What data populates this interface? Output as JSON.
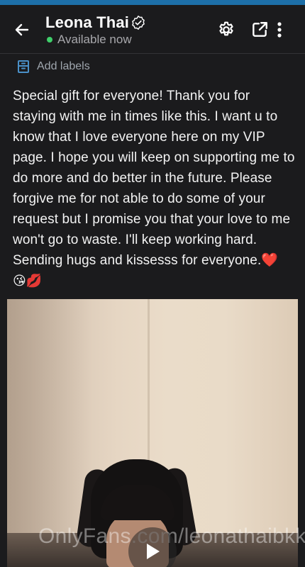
{
  "header": {
    "name": "Leona Thai",
    "status": "Available now",
    "status_color": "#3fcf6a"
  },
  "icons": {
    "back": "arrow-left-icon",
    "verified": "verified-badge-icon",
    "settings": "gear-icon",
    "share": "share-icon",
    "more": "more-vertical-icon",
    "labels": "label-icon",
    "play": "play-icon"
  },
  "labels": {
    "add_label": "Add labels"
  },
  "message": {
    "text": "Special gift for everyone! Thank you for staying with me in times like this. I want u to know that I love everyone here on my VIP page. I hope you will keep on supporting me to do more and do better in the future. Please forgive me for not able to do some of your request but I promise you that your love to me won't go to waste. I'll keep working hard. Sending hugs and kissesss for everyone.❤️",
    "emojis": "😘💋"
  },
  "media": {
    "watermark": "OnlyFans.com/leonathaibkk"
  },
  "colors": {
    "background": "#1b1b1d",
    "accent": "#1d6fa8",
    "label_icon": "#4a90c8"
  }
}
